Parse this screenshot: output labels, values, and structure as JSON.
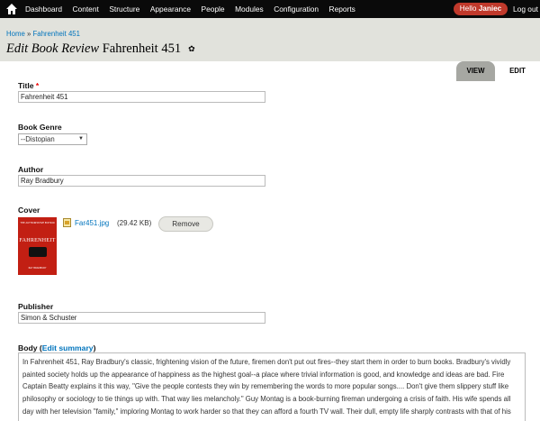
{
  "toolbar": {
    "menu": [
      "Dashboard",
      "Content",
      "Structure",
      "Appearance",
      "People",
      "Modules",
      "Configuration",
      "Reports"
    ],
    "user_greeting": "Hello",
    "user_name": "Janiec",
    "logout": "Log out"
  },
  "breadcrumb": {
    "home": "Home",
    "separator": "»",
    "current": "Fahrenheit 451"
  },
  "page_title": {
    "prefix": "Edit Book Review",
    "name": "Fahrenheit 451"
  },
  "tabs": {
    "view": "VIEW",
    "edit": "EDIT"
  },
  "form": {
    "title_label": "Title",
    "required_mark": "*",
    "title_value": "Fahrenheit 451",
    "genre_label": "Book Genre",
    "genre_value": "--Distopian",
    "author_label": "Author",
    "author_value": "Ray Bradbury",
    "cover_label": "Cover",
    "cover_file": "Far451.jpg",
    "cover_size": "(29.42 KB)",
    "remove_label": "Remove",
    "publisher_label": "Publisher",
    "publisher_value": "Simon & Schuster",
    "body_label": "Body",
    "body_link": "Edit summary",
    "body_text": "In Fahrenheit 451, Ray Bradbury's classic, frightening vision of the future, firemen don't put out fires--they start them in order to burn books. Bradbury's vividly painted society holds up the appearance of happiness as the highest goal--a place where trivial information is good, and knowledge and ideas are bad. Fire Captain Beatty explains it this way, \"Give the people contests they win by remembering the words to more popular songs.... Don't give them slippery stuff like philosophy or sociology to tie things up with. That way lies melancholy.\" Guy Montag is a book-burning fireman undergoing a crisis of faith. His wife spends all day with her television \"family,\" imploring Montag to work harder so that they can afford a fourth TV wall. Their dull, empty life sharply contrasts with that of his next door neighbor Clarisse, a young girl"
  },
  "cover_art": {
    "top_line": "THE AUTHORITATIVE EDITION",
    "title": "FAHRENHEIT",
    "bottom_line": "RAY BRADBURY"
  },
  "colors": {
    "toolbar": "#0a0a0a",
    "header": "#e1e2dc",
    "link": "#0074bd",
    "user_badge": "#c0392b",
    "cover": "#c21f13"
  }
}
